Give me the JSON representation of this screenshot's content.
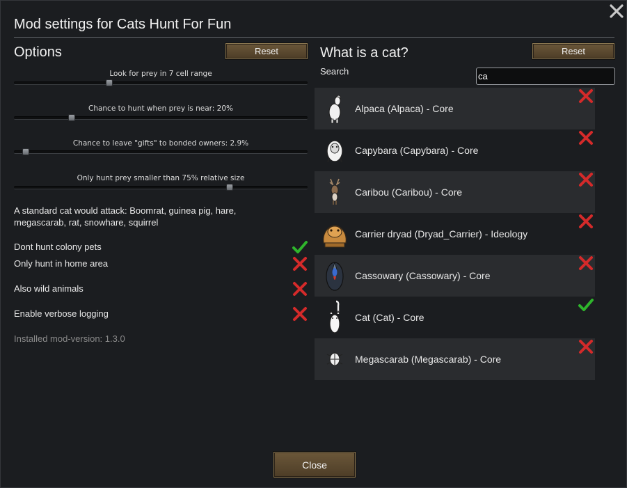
{
  "dialog": {
    "title": "Mod settings for Cats Hunt For Fun",
    "close_label": "Close"
  },
  "options": {
    "title": "Options",
    "reset_label": "Reset",
    "sliders": [
      {
        "label": "Look for prey in 7 cell range",
        "fraction": 0.32
      },
      {
        "label": "Chance to hunt when prey is near: 20%",
        "fraction": 0.19
      },
      {
        "label": "Chance to leave \"gifts\" to bonded owners: 2.9%",
        "fraction": 0.03
      },
      {
        "label": "Only hunt prey smaller than 75% relative size",
        "fraction": 0.74
      }
    ],
    "attack_description": "A standard cat would attack: Boomrat, guinea pig, hare,\nmegascarab, rat, snowhare, squirrel",
    "toggles": [
      {
        "label": "Dont hunt colony pets",
        "enabled": true
      },
      {
        "label": "Only hunt in home area",
        "enabled": false
      },
      {
        "label": "Also wild animals",
        "enabled": false
      },
      {
        "label": "Enable verbose logging",
        "enabled": false
      }
    ],
    "version_text": "Installed mod-version: 1.3.0"
  },
  "cats": {
    "title": "What is a cat?",
    "reset_label": "Reset",
    "search_label": "Search",
    "search_value": "ca",
    "animals": [
      {
        "name": "Alpaca (Alpaca) - Core",
        "icon": "alpaca-icon",
        "is_cat": false
      },
      {
        "name": "Capybara (Capybara) - Core",
        "icon": "capybara-icon",
        "is_cat": false
      },
      {
        "name": "Caribou (Caribou) - Core",
        "icon": "caribou-icon",
        "is_cat": false
      },
      {
        "name": "Carrier dryad (Dryad_Carrier) - Ideology",
        "icon": "carrier-dryad-icon",
        "is_cat": false
      },
      {
        "name": "Cassowary (Cassowary) - Core",
        "icon": "cassowary-icon",
        "is_cat": false
      },
      {
        "name": "Cat (Cat) - Core",
        "icon": "cat-icon",
        "is_cat": true
      },
      {
        "name": "Megascarab (Megascarab) - Core",
        "icon": "megascarab-icon",
        "is_cat": false
      }
    ]
  },
  "colors": {
    "check": "#2fb52c",
    "cross": "#d42a2a",
    "button": "#5c4a31"
  }
}
